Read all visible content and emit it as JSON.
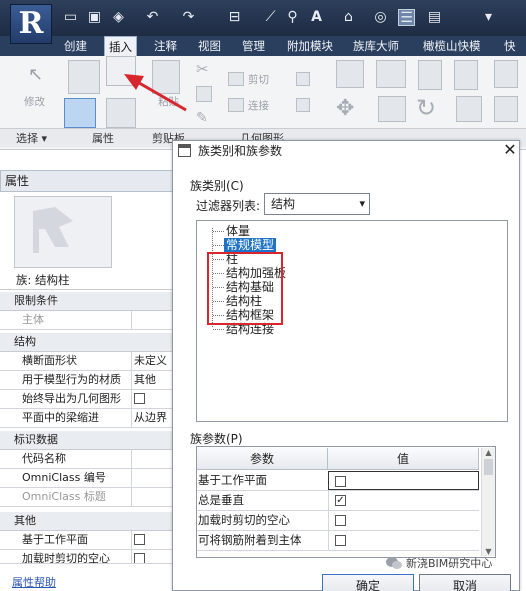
{
  "app": {
    "logo_letter": "R"
  },
  "ribbon": {
    "tabs": [
      "创建",
      "插入",
      "注释",
      "视图",
      "管理",
      "附加模块",
      "族库大师",
      "橄榄山快模",
      "快"
    ],
    "buttons": {
      "modify": "修改",
      "cut": "剪切",
      "connect": "连接",
      "paste": "粘贴"
    },
    "groups": [
      "选择",
      "属性",
      "剪贴板",
      "几何图形"
    ]
  },
  "properties": {
    "title": "属性",
    "family": "族: 结构柱",
    "sections": [
      {
        "name": "限制条件",
        "rows": [
          {
            "name": "主体",
            "value": ""
          }
        ]
      },
      {
        "name": "结构",
        "rows": [
          {
            "name": "横断面形状",
            "value": "未定义"
          },
          {
            "name": "用于模型行为的材质",
            "value": "其他"
          },
          {
            "name": "始终导出为几何图形",
            "value": "checkbox"
          },
          {
            "name": "平面中的梁缩进",
            "value": "从边界"
          }
        ]
      },
      {
        "name": "标识数据",
        "rows": [
          {
            "name": "代码名称",
            "value": ""
          },
          {
            "name": "OmniClass 编号",
            "value": ""
          },
          {
            "name": "OmniClass 标题",
            "value": ""
          }
        ]
      },
      {
        "name": "其他",
        "rows": [
          {
            "name": "基于工作平面",
            "value": "checkbox"
          },
          {
            "name": "加载时剪切的空心",
            "value": "checkbox"
          }
        ]
      }
    ],
    "help_link": "属性帮助"
  },
  "dialog": {
    "title": "族类别和族参数",
    "close": "✕",
    "category_label": "族类别(C)",
    "filter_label": "过滤器列表:",
    "filter_value": "结构",
    "tree_items": [
      "体量",
      "常规模型",
      "柱",
      "结构加强板",
      "结构基础",
      "结构柱",
      "结构框架",
      "结构连接"
    ],
    "selected_item": "常规模型",
    "highlighted_items": [
      "结构基础",
      "结构柱",
      "结构框架"
    ],
    "params_label": "族参数(P)",
    "params_headers": [
      "参数",
      "值"
    ],
    "params": [
      {
        "name": "基于工作平面",
        "checked": false
      },
      {
        "name": "总是垂直",
        "checked": true
      },
      {
        "name": "加载时剪切的空心",
        "checked": false
      },
      {
        "name": "可将钢筋附着到主体",
        "checked": false
      }
    ],
    "ok_label": "确定",
    "cancel_label": "取消"
  },
  "watermark": "新浇BIM研究中心",
  "annotation_color": "#d8262e",
  "selection_color": "#1e73c9"
}
